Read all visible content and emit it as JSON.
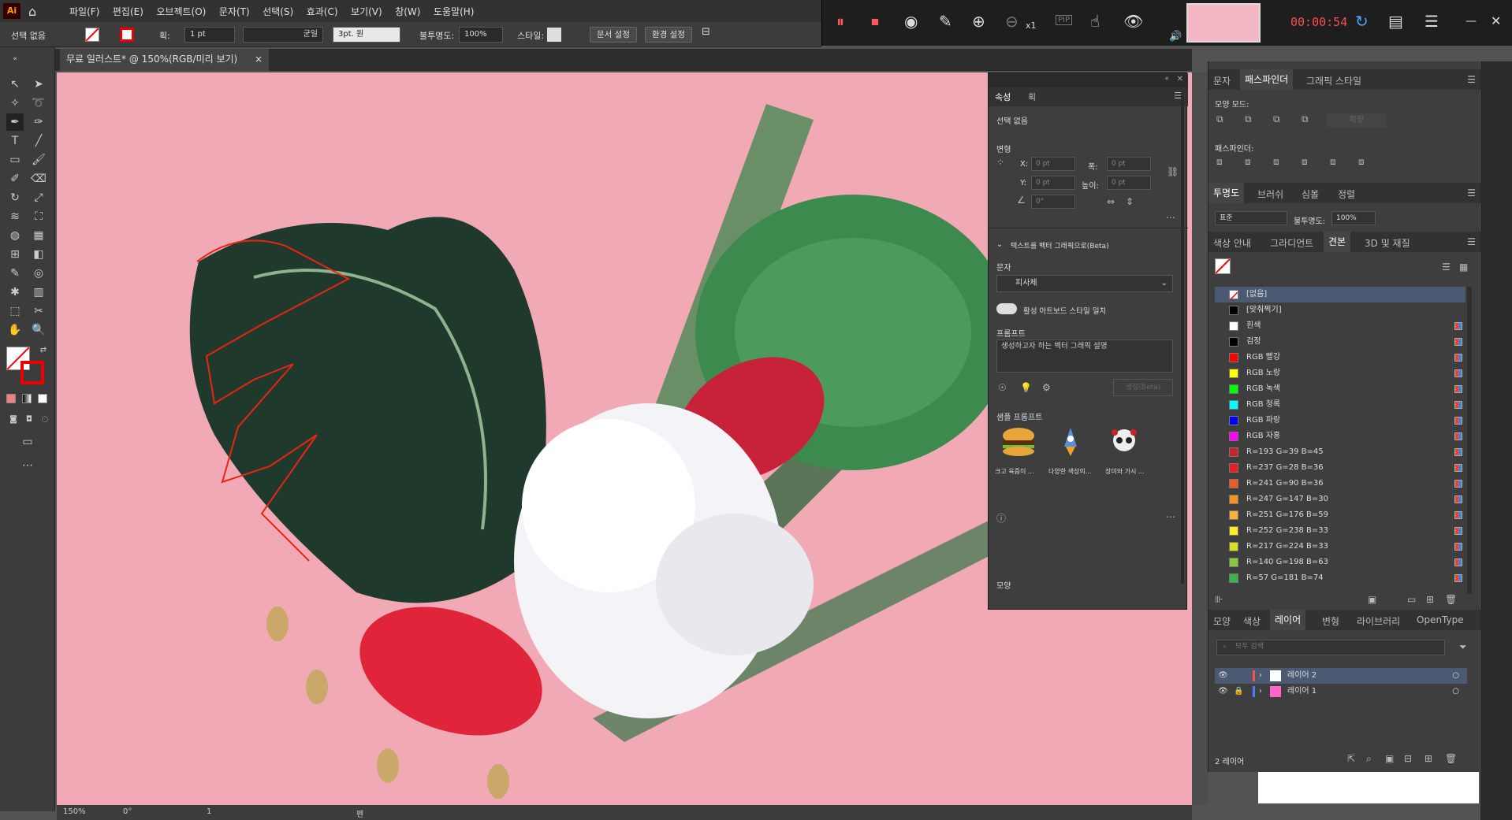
{
  "menubar": {
    "logo": "Ai",
    "items": [
      "파일(F)",
      "편집(E)",
      "오브젝트(O)",
      "문자(T)",
      "선택(S)",
      "효과(C)",
      "보기(V)",
      "창(W)",
      "도움말(H)"
    ]
  },
  "recorder": {
    "time": "00:00:54",
    "zoom_label": "x1",
    "pip_label": "PIP"
  },
  "control": {
    "selection": "선택 없음",
    "stroke_label": "획:",
    "stroke_value": "1 pt",
    "line_style": "균일",
    "brush": "3pt. 원",
    "opacity_label": "불투명도:",
    "opacity_value": "100%",
    "style_label": "스타일:",
    "doc_setup": "문서 설정",
    "prefs": "환경 설정"
  },
  "document": {
    "tab_title": "무료 일러스트* @ 150%(RGB/미리 보기)"
  },
  "status": {
    "zoom": "150%",
    "rotation": "0°",
    "artboard": "1",
    "tool": "펜"
  },
  "properties": {
    "tabs": [
      "속성",
      "획"
    ],
    "selection": "선택 없음",
    "transform_label": "변형",
    "x_label": "X:",
    "y_label": "Y:",
    "w_label": "폭:",
    "h_label": "높이:",
    "zero": "0 pt",
    "angle": "0°",
    "text_to_vector": "텍스트를 벡터 그래픽으로(Beta)",
    "subject_label": "문자",
    "subject_value": "피사체",
    "toggle_label": "활성 아트보드 스타일 일치",
    "prompt_label": "프롬프트",
    "prompt_placeholder": "생성하고자 하는 벡터 그래픽 설명",
    "generate": "생성(Beta)",
    "samples_label": "샘플 프롬프트",
    "samples": [
      "크고 육즙이 ...",
      "다양한 색상의...",
      "장미와 가시 ..."
    ],
    "appearance_label": "모양"
  },
  "pathfinder": {
    "tabs": [
      "문자",
      "패스파인더",
      "그래픽 스타일"
    ],
    "shape_modes": "모양 모드:",
    "expand": "확장",
    "pathfinders": "패스파인더:"
  },
  "transparency": {
    "tabs": [
      "투명도",
      "브러쉬",
      "심볼",
      "정렬"
    ],
    "mode": "표준",
    "opacity_label": "불투명도:",
    "opacity": "100%"
  },
  "swatches": {
    "tabs": [
      "색상 안내",
      "그라디언트",
      "견본",
      "3D 및 재질"
    ],
    "items": [
      {
        "name": "[없음]",
        "color": "none"
      },
      {
        "name": "[맞춰찍기]",
        "color": "#000000"
      },
      {
        "name": "흰색",
        "color": "#ffffff"
      },
      {
        "name": "검정",
        "color": "#000000"
      },
      {
        "name": "RGB 빨강",
        "color": "#ff0000"
      },
      {
        "name": "RGB 노랑",
        "color": "#ffff00"
      },
      {
        "name": "RGB 녹색",
        "color": "#00ff00"
      },
      {
        "name": "RGB 청록",
        "color": "#00ffff"
      },
      {
        "name": "RGB 파랑",
        "color": "#0000ff"
      },
      {
        "name": "RGB 자홍",
        "color": "#ff00ff"
      },
      {
        "name": "R=193 G=39 B=45",
        "color": "#c1272d"
      },
      {
        "name": "R=237 G=28 B=36",
        "color": "#ed1c24"
      },
      {
        "name": "R=241 G=90 B=36",
        "color": "#f15a24"
      },
      {
        "name": "R=247 G=147 B=30",
        "color": "#f7931e"
      },
      {
        "name": "R=251 G=176 B=59",
        "color": "#fbb03b"
      },
      {
        "name": "R=252 G=238 B=33",
        "color": "#fcee21"
      },
      {
        "name": "R=217 G=224 B=33",
        "color": "#d9e021"
      },
      {
        "name": "R=140 G=198 B=63",
        "color": "#8cc63f"
      },
      {
        "name": "R=57 G=181 B=74",
        "color": "#39b54a"
      }
    ]
  },
  "layers": {
    "tabs": [
      "모양",
      "색상",
      "레이어",
      "변형",
      "라이브러리",
      "OpenType"
    ],
    "search_placeholder": "모두 검색",
    "items": [
      {
        "name": "레이어 2",
        "color": "#ff4d4d"
      },
      {
        "name": "레이어 1",
        "color": "#4d79ff"
      }
    ],
    "count": "2 레이어"
  }
}
